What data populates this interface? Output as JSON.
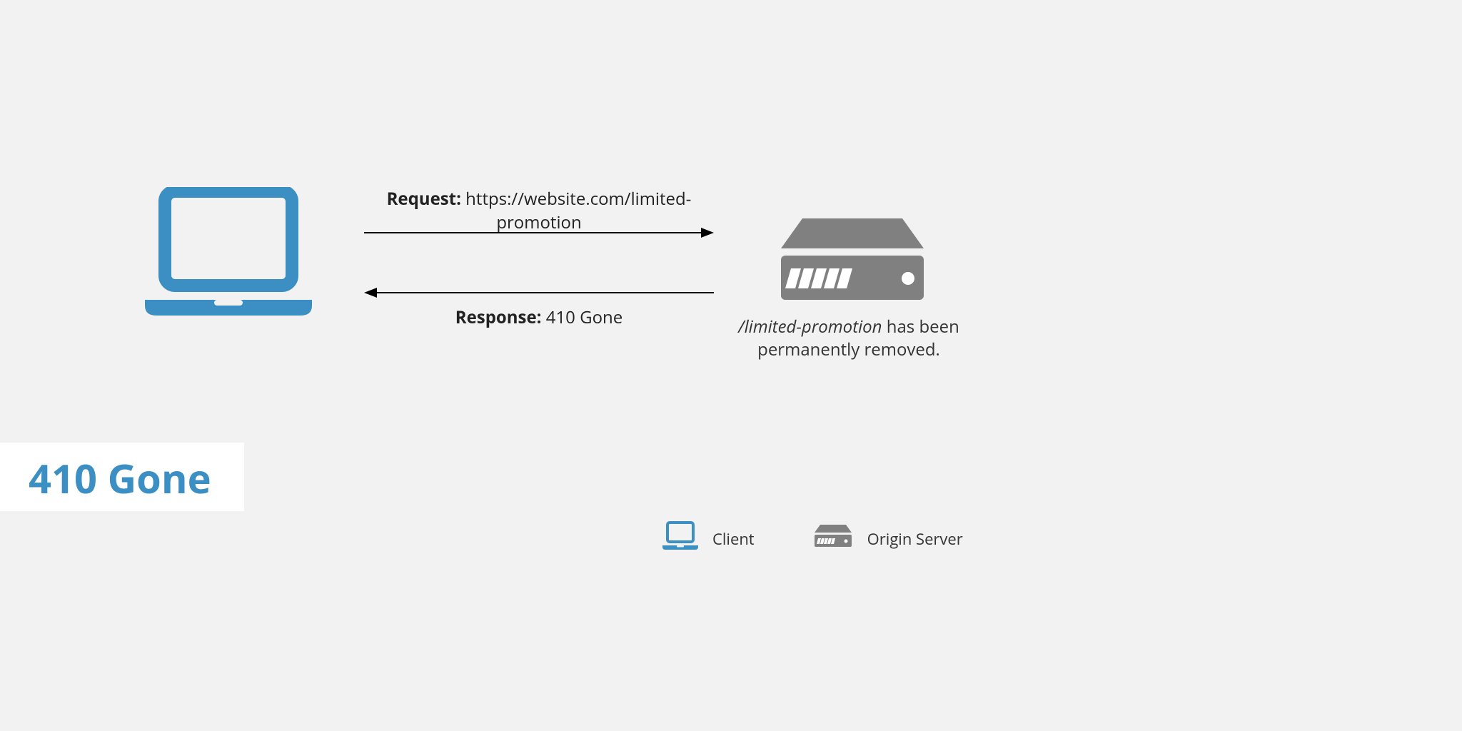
{
  "colors": {
    "accent": "#3b8fc2",
    "server": "#808080",
    "line": "#000000"
  },
  "request": {
    "label": "Request:",
    "url": "https://website.com/limited-promotion"
  },
  "response": {
    "label": "Response:",
    "value": "410 Gone"
  },
  "server_caption": {
    "path": "/limited-promotion",
    "rest_line1": " has been",
    "line2": "permanently removed."
  },
  "title": "410 Gone",
  "legend": {
    "client": "Client",
    "origin": "Origin Server"
  }
}
